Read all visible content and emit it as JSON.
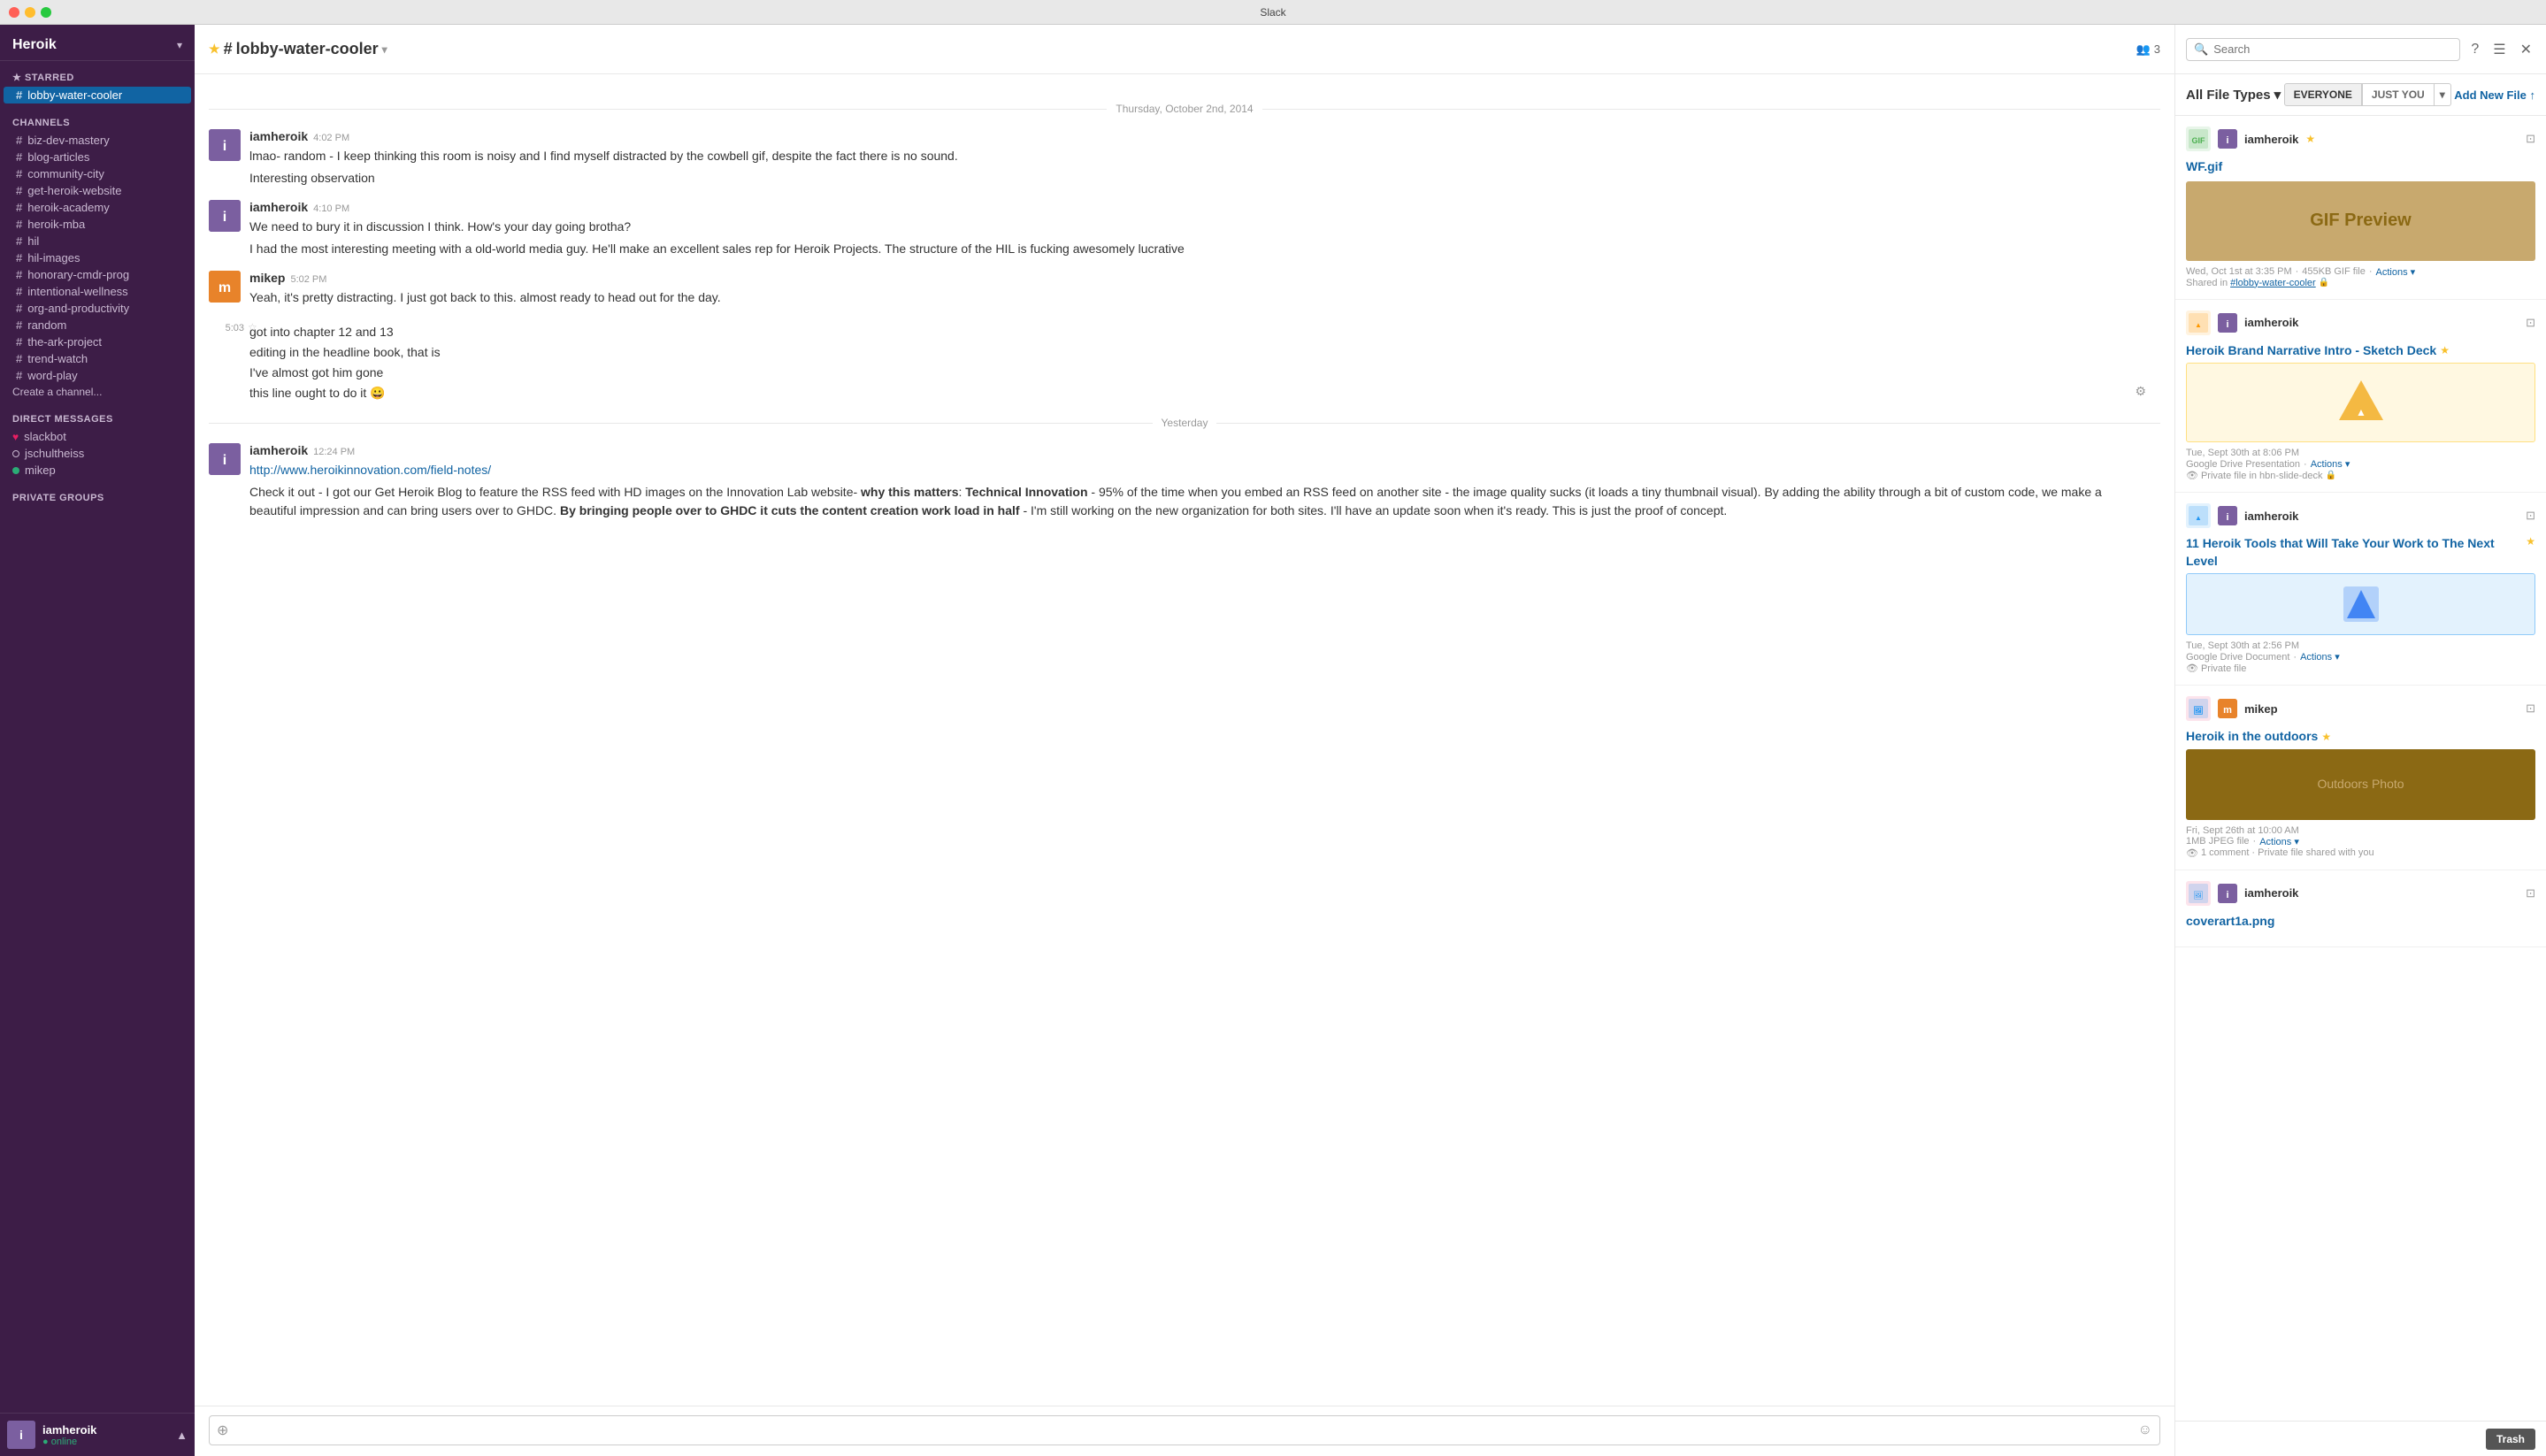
{
  "app": {
    "title": "Slack"
  },
  "titlebar": {
    "title": "Slack",
    "buttons": [
      "close",
      "minimize",
      "maximize"
    ]
  },
  "sidebar": {
    "team_name": "Heroik",
    "starred_section": "STARRED",
    "starred_channels": [
      {
        "name": "lobby-water-cooler",
        "active": true
      }
    ],
    "channels_section": "CHANNELS",
    "channels": [
      {
        "name": "biz-dev-mastery"
      },
      {
        "name": "blog-articles"
      },
      {
        "name": "community-city"
      },
      {
        "name": "get-heroik-website"
      },
      {
        "name": "heroik-academy"
      },
      {
        "name": "heroik-mba"
      },
      {
        "name": "hil"
      },
      {
        "name": "hil-images"
      },
      {
        "name": "honorary-cmdr-prog"
      },
      {
        "name": "intentional-wellness"
      },
      {
        "name": "org-and-productivity"
      },
      {
        "name": "random"
      },
      {
        "name": "the-ark-project"
      },
      {
        "name": "trend-watch"
      },
      {
        "name": "word-play"
      }
    ],
    "create_channel_label": "Create a channel...",
    "dm_section": "DIRECT MESSAGES",
    "direct_messages": [
      {
        "name": "slackbot",
        "status": "online",
        "icon": "♥"
      },
      {
        "name": "jschultheiss",
        "status": "offline"
      },
      {
        "name": "mikep",
        "status": "online"
      }
    ],
    "private_groups_section": "PRIVATE GROUPS",
    "footer": {
      "user_name": "iamheroik",
      "status": "online",
      "status_label": "● online"
    }
  },
  "chat": {
    "channel_name": "#lobby-water-cooler",
    "channel_members": 3,
    "date_dividers": [
      "Thursday, October 2nd, 2014",
      "Yesterday"
    ],
    "messages": [
      {
        "id": "msg1",
        "author": "iamheroik",
        "time": "4:02 PM",
        "text": "lmao- random - I keep thinking this room is noisy and I find myself distracted by the cowbell gif, despite the fact there is no sound.",
        "continuation": [
          "Interesting observation"
        ]
      },
      {
        "id": "msg2",
        "author": "iamheroik",
        "time": "4:10 PM",
        "text": "We need to bury it in discussion I think. How's your day going brotha?",
        "continuation": [
          "I had the most interesting meeting with a old-world media guy. He'll make an excellent sales rep for Heroik Projects. The structure of the HIL is fucking awesomely lucrative"
        ]
      },
      {
        "id": "msg3",
        "author": "mikep",
        "time": "5:02 PM",
        "text": "Yeah, it's pretty distracting.  I just got back to this.  almost ready to head out for the day."
      },
      {
        "id": "msg4",
        "time": "5:03",
        "starred": true,
        "lines": [
          "got into chapter 12 and 13",
          "editing in the headline book, that is",
          "I've almost got him gone",
          "this line ought to do it 😀"
        ]
      },
      {
        "id": "msg5",
        "author": "iamheroik",
        "time": "12:24 PM",
        "link": "http://www.heroikinnovation.com/field-notes/",
        "text_before": "Check it out - I got our Get Heroik Blog to feature the RSS feed with HD images on the Innovation Lab website- ",
        "bold_phrase": "why this matters",
        "colon": ":  ",
        "bold_phrase2": "Technical Innovation",
        "text_after": " - 95% of the time when you embed an RSS feed on another site - the image quality sucks (it loads a tiny thumbnail visual).  By adding the ability through a bit of custom code, we make a beautiful impression and can bring users over to GHDC. ",
        "bold_phrase3": "By bringing people over to GHDC it cuts the content creation work load in half",
        "text_end": " - I'm still working on the new organization for both sites. I'll have an update soon when it's ready. This is just the proof of concept."
      }
    ],
    "input_placeholder": ""
  },
  "right_panel": {
    "search_placeholder": "Search",
    "file_type_label": "All File Types",
    "filter_everyone": "EVERYONE",
    "filter_just_you": "JUST YOU",
    "add_new_file": "Add New File ↑",
    "files": [
      {
        "id": "f1",
        "user": "iamheroik",
        "type": "gif",
        "title": "WF.gif",
        "starred": true,
        "date": "Wed, Oct 1st at 3:35 PM",
        "meta": "455KB GIF file",
        "actions": "Actions",
        "shared_in": "#lobby-water-cooler",
        "has_preview": true,
        "preview_color": "#c8a96e"
      },
      {
        "id": "f2",
        "user": "iamheroik",
        "type": "sketch",
        "title": "Heroik Brand Narrative Intro - Sketch Deck",
        "starred": true,
        "date": "Tue, Sept 30th at 8:06 PM",
        "meta": "Google Drive Presentation",
        "actions": "Actions",
        "private_in": "hbn-slide-deck",
        "is_private": true,
        "has_preview": false
      },
      {
        "id": "f3",
        "user": "iamheroik",
        "type": "gdoc",
        "title": "11 Heroik Tools that Will Take Your Work to The Next Level",
        "starred": true,
        "date": "Tue, Sept 30th at 2:56 PM",
        "meta": "Google Drive Document",
        "actions": "Actions",
        "private_label": "Private file",
        "has_preview": false
      },
      {
        "id": "f4",
        "user": "mikep",
        "type": "img",
        "title": "Heroik in the outdoors",
        "starred": true,
        "date": "Fri, Sept 26th at 10:00 AM",
        "meta": "1MB JPEG file",
        "actions": "Actions",
        "comments": "1 comment",
        "shared_private": "Private file shared with you",
        "has_preview": true,
        "preview_color": "#8b6914"
      },
      {
        "id": "f5",
        "user": "iamheroik",
        "type": "img",
        "title": "coverart1a.png",
        "starred": false,
        "has_preview": false
      }
    ],
    "trash_label": "Trash"
  }
}
